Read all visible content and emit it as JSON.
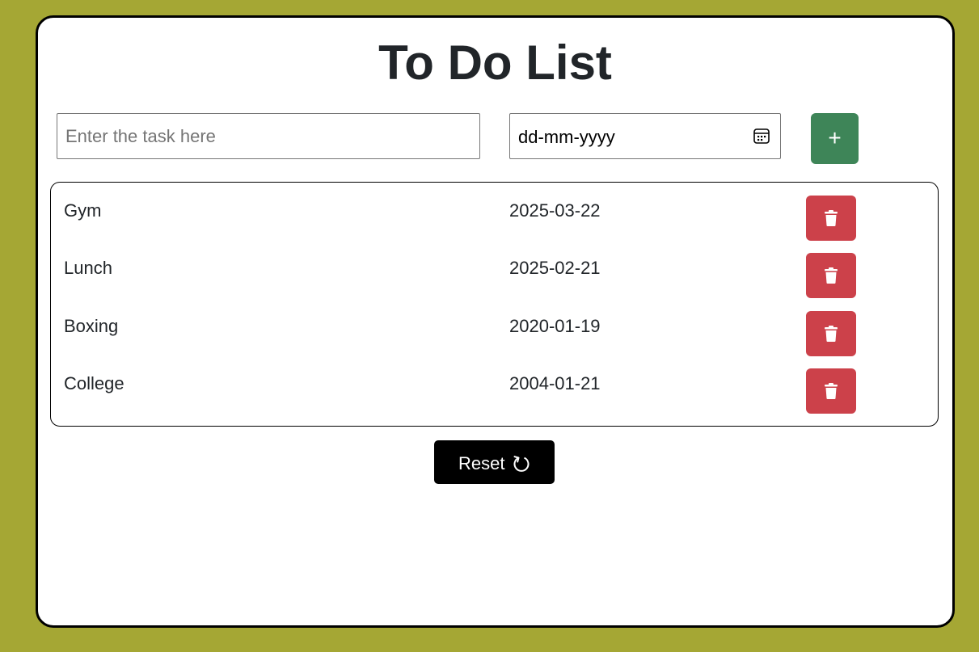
{
  "page": {
    "title": "To Do List"
  },
  "colors": {
    "background": "#a5a734",
    "card": "#ffffff",
    "add_button": "#3e8558",
    "delete_button": "#cc414a",
    "reset_button": "#000000"
  },
  "form": {
    "task_placeholder": "Enter the task here",
    "task_value": "",
    "date_placeholder": "dd-mm-yyyy",
    "date_icon": "calendar-icon",
    "add_label": "+",
    "add_icon": "plus-icon"
  },
  "tasks": [
    {
      "name": "Gym",
      "date": "2025-03-22",
      "delete_icon": "trash-icon"
    },
    {
      "name": "Lunch",
      "date": "2025-02-21",
      "delete_icon": "trash-icon"
    },
    {
      "name": "Boxing",
      "date": "2020-01-19",
      "delete_icon": "trash-icon"
    },
    {
      "name": "College",
      "date": "2004-01-21",
      "delete_icon": "trash-icon"
    }
  ],
  "reset": {
    "label": "Reset",
    "icon": "refresh-icon"
  }
}
